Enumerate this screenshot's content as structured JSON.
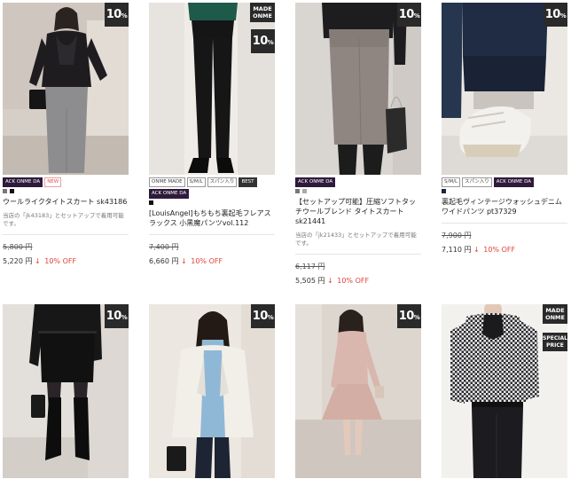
{
  "products": [
    {
      "badge": "10%",
      "tags": [
        "ACK ONME DA",
        "NEW"
      ],
      "dots": [
        "#777777",
        "#111111"
      ],
      "name": "ウールライクタイトスカート sk43186",
      "note": "当店の「jk43183」とセットアップで着用可能です。",
      "original_price": "5,800 円",
      "sale_price": "5,220 円",
      "arrow": "↓",
      "discount": "10% OFF"
    },
    {
      "made_badge": "MADE ONME",
      "badge": "10%",
      "tags": [
        "ONME MADE",
        "S/M/L",
        "スパン入り",
        "BEST",
        "ACK ONME DA"
      ],
      "dots": [
        "#111111"
      ],
      "name": "[LouisAngel]もちもち裏起毛フレアスラックス 小黒魔パンツvol.112",
      "original_price": "7,400 円",
      "sale_price": "6,660 円",
      "arrow": "↓",
      "discount": "10% OFF"
    },
    {
      "badge": "10%",
      "tags": [
        "ACK ONME DA"
      ],
      "dots": [
        "#777777",
        "#aaaaaa"
      ],
      "name": "【セットアップ可能】圧縮ソフトタッチウールブレンド タイトスカート sk21441",
      "note": "当店の「jk21433」とセットアップで着用可能です。",
      "original_price": "6,117 円",
      "sale_price": "5,505 円",
      "arrow": "↓",
      "discount": "10% OFF"
    },
    {
      "badge": "10%",
      "tags": [
        "S/M/L",
        "スパン入り",
        "ACK ONME DA"
      ],
      "dots": [
        "#1a2540"
      ],
      "name": "裏起毛ヴィンテージウォッシュデニムワイドパンツ pt37329",
      "original_price": "7,900 円",
      "sale_price": "7,110 円",
      "arrow": "↓",
      "discount": "10% OFF"
    },
    {
      "badge": "10%"
    },
    {
      "badge": "10%"
    },
    {
      "badge": "10%"
    },
    {
      "made_badge": "MADE ONME",
      "special_badge": "SPECIAL PRICE"
    }
  ]
}
